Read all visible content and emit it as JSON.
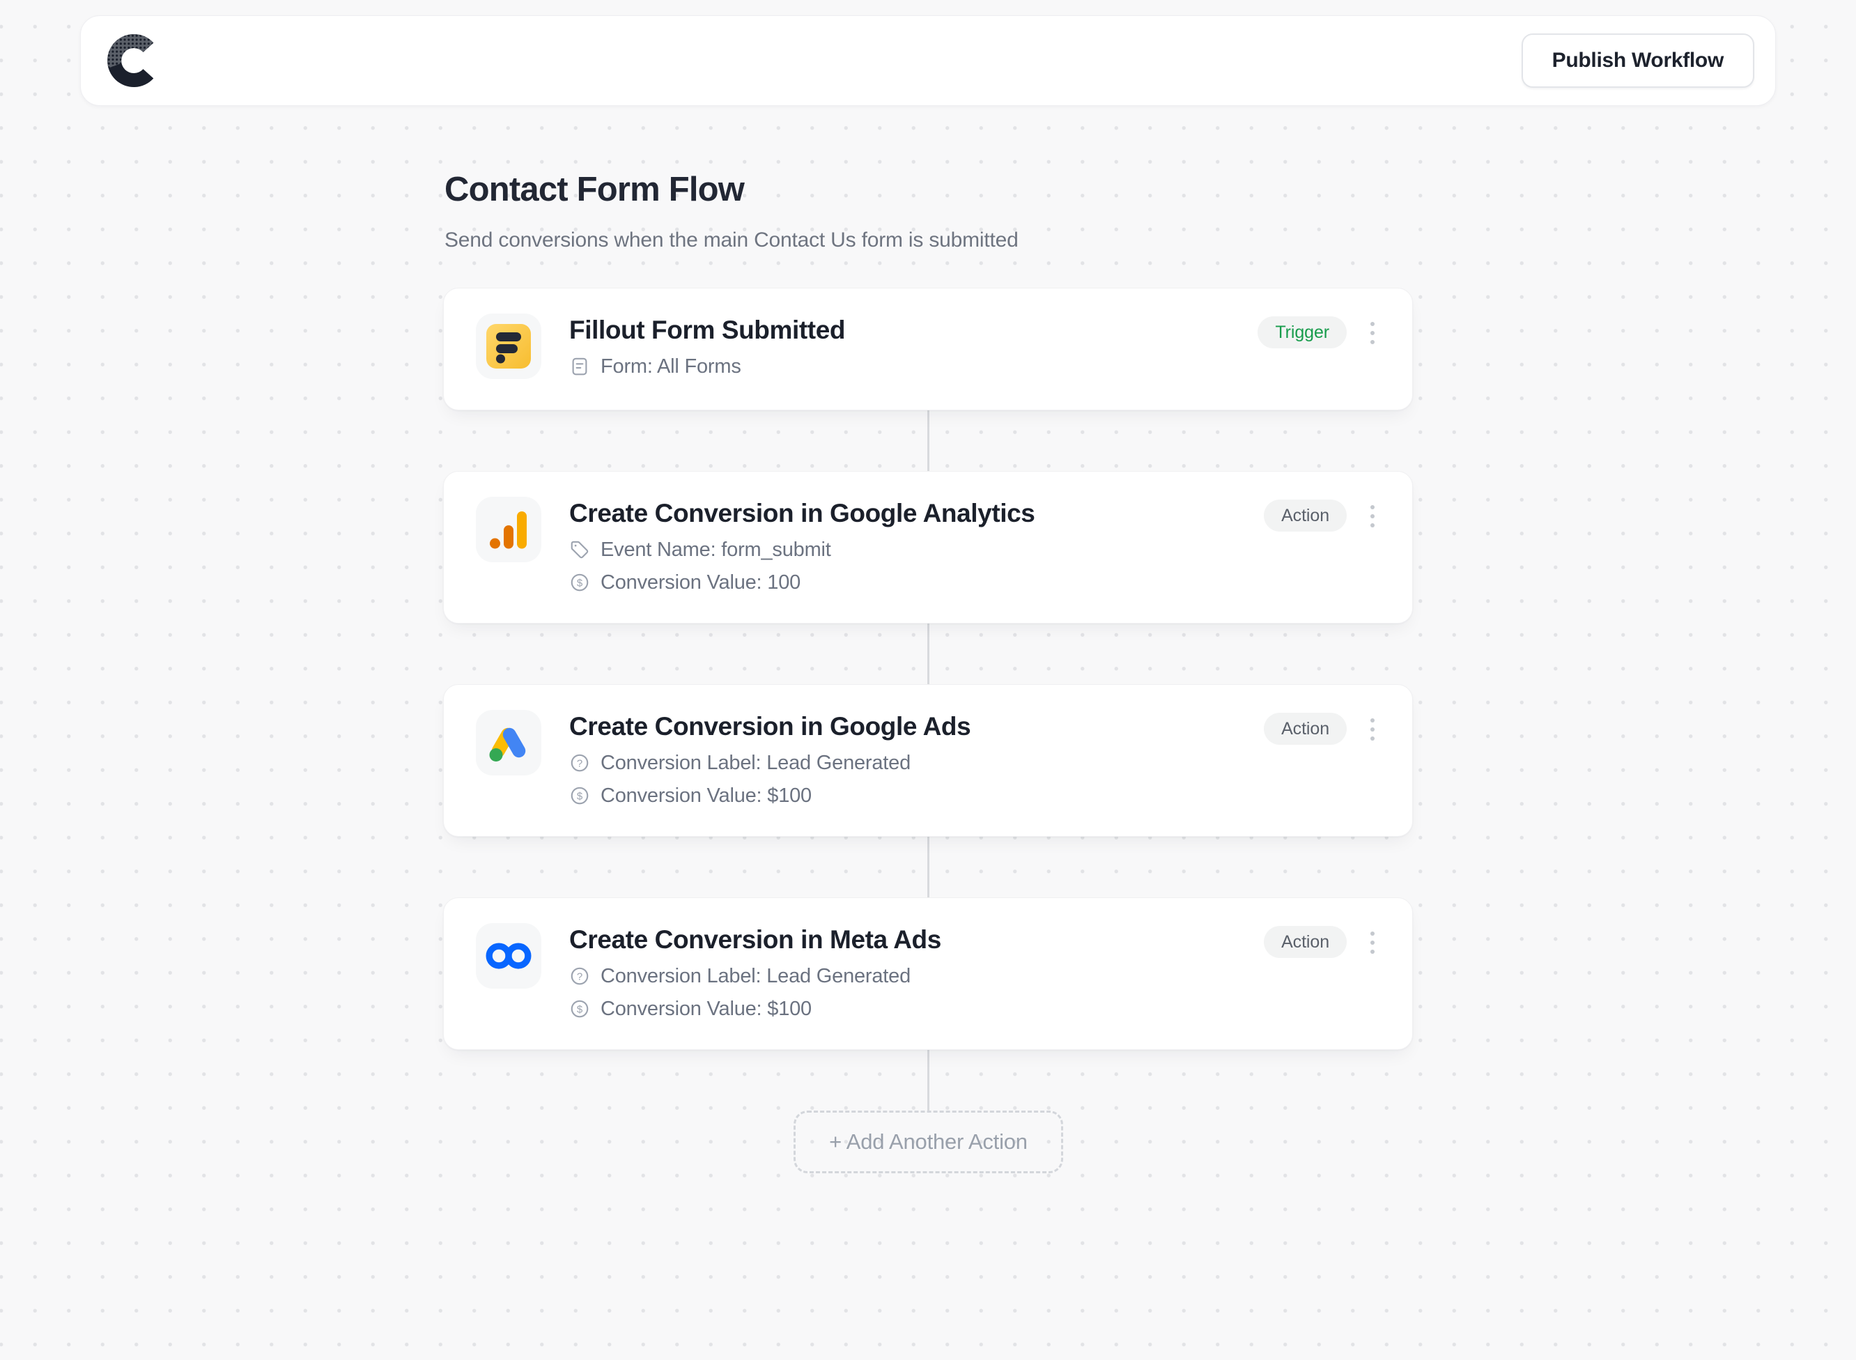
{
  "header": {
    "logo_letter": "C",
    "publish_label": "Publish Workflow"
  },
  "page": {
    "title": "Contact Form Flow",
    "subtitle": "Send conversions when the main Contact Us form is submitted"
  },
  "workflow": {
    "steps": [
      {
        "title": "Fillout Form Submitted",
        "badge": "Trigger",
        "icon": "fillout-icon",
        "details": [
          {
            "icon": "form-icon",
            "text": "Form: All Forms"
          }
        ]
      },
      {
        "title": "Create Conversion in Google Analytics",
        "badge": "Action",
        "icon": "google-analytics-icon",
        "details": [
          {
            "icon": "tag-icon",
            "text": "Event Name: form_submit"
          },
          {
            "icon": "dollar-icon",
            "text": "Conversion Value: 100"
          }
        ]
      },
      {
        "title": "Create Conversion in Google Ads",
        "badge": "Action",
        "icon": "google-ads-icon",
        "details": [
          {
            "icon": "question-icon",
            "text": "Conversion Label: Lead Generated"
          },
          {
            "icon": "dollar-icon",
            "text": "Conversion Value: $100"
          }
        ]
      },
      {
        "title": "Create Conversion in Meta Ads",
        "badge": "Action",
        "icon": "meta-icon",
        "details": [
          {
            "icon": "question-icon",
            "text": "Conversion Label: Lead Generated"
          },
          {
            "icon": "dollar-icon",
            "text": "Conversion Value: $100"
          }
        ]
      }
    ],
    "add_action_label": "+ Add Another Action"
  },
  "colors": {
    "trigger_text": "#189C4C",
    "action_text": "#5A606A",
    "badge_bg": "#F2F3F3",
    "fillout_yellow": "#F9BE2B",
    "ga_dark_orange": "#E37400",
    "ga_yellow": "#F9AB00",
    "ads_blue": "#4285F4",
    "ads_yellow": "#FBBC04",
    "ads_green": "#34A853",
    "meta_blue": "#0866FF",
    "logo_dark": "#1B202C"
  }
}
